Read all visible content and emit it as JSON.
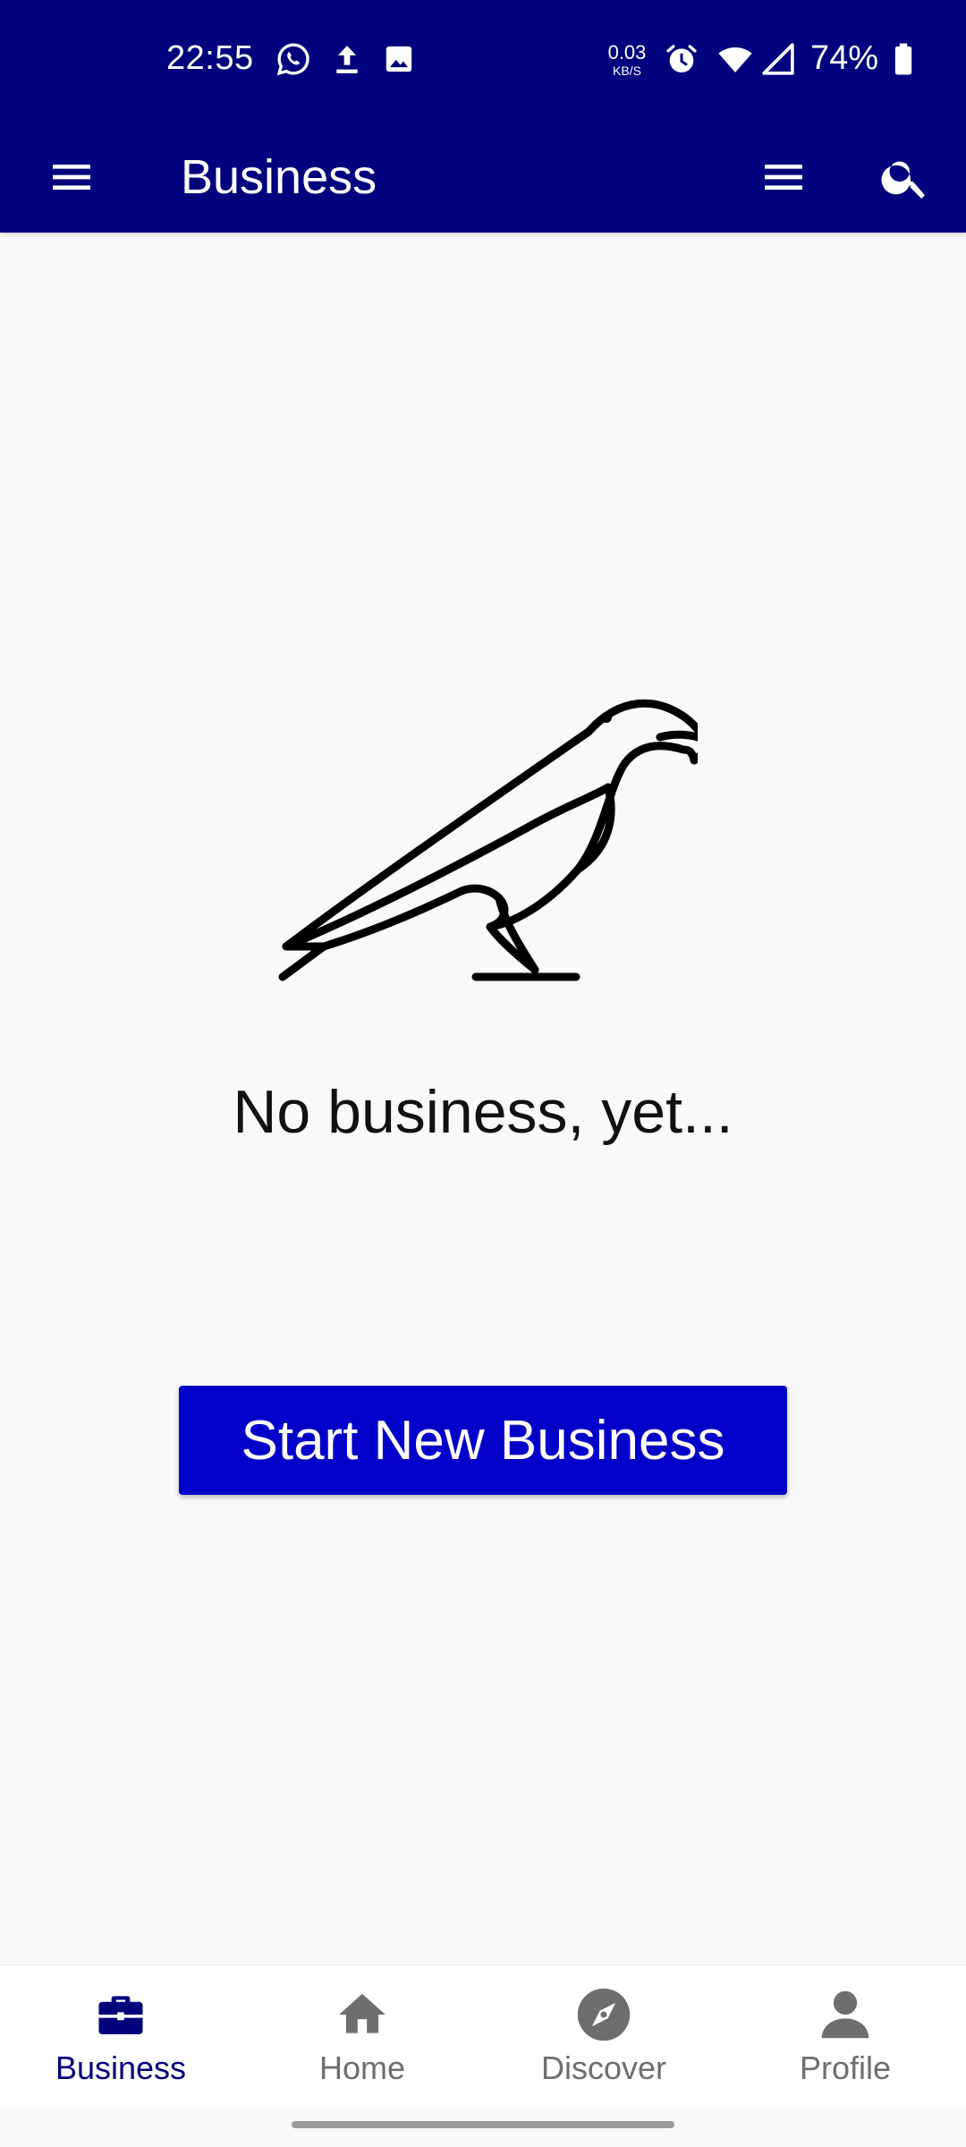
{
  "status_bar": {
    "time": "22:55",
    "net_speed_value": "0.03",
    "net_speed_unit": "KB/S",
    "battery_percent": "74%",
    "icons": [
      "whatsapp-icon",
      "upload-icon",
      "image-icon",
      "alarm-icon",
      "wifi-icon",
      "signal-icon",
      "battery-icon"
    ]
  },
  "app_bar": {
    "title": "Business",
    "background_color": "#02027d"
  },
  "empty_state": {
    "illustration": "crow-icon",
    "message": "No business, yet...",
    "action_label": "Start New Business",
    "action_color": "#0000c8"
  },
  "bottom_nav": {
    "items": [
      {
        "label": "Business",
        "icon": "briefcase-icon",
        "active": true
      },
      {
        "label": "Home",
        "icon": "home-icon",
        "active": false
      },
      {
        "label": "Discover",
        "icon": "compass-icon",
        "active": false
      },
      {
        "label": "Profile",
        "icon": "person-icon",
        "active": false
      }
    ],
    "active_color": "#02027d",
    "inactive_color": "#6e6e6e"
  }
}
